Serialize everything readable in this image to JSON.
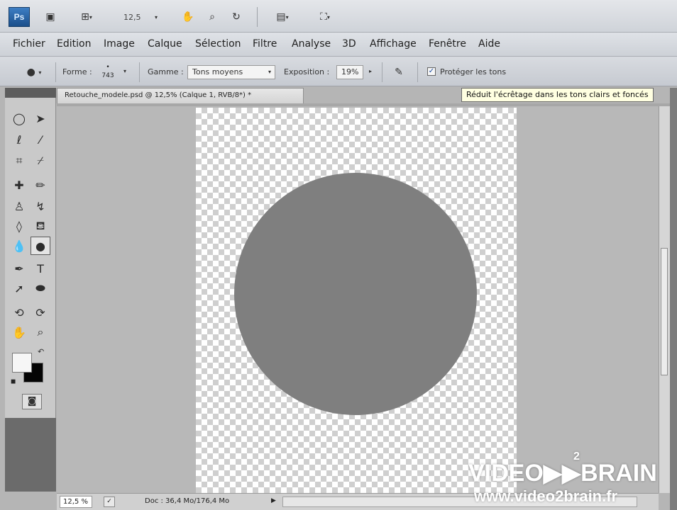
{
  "appbar": {
    "logo": "Ps",
    "zoom": "12,5"
  },
  "menu": {
    "items": [
      "Fichier",
      "Edition",
      "Image",
      "Calque",
      "Sélection",
      "Filtre",
      "Analyse",
      "3D",
      "Affichage",
      "Fenêtre",
      "Aide"
    ]
  },
  "options": {
    "forme_label": "Forme :",
    "brush_size": "743",
    "gamme_label": "Gamme :",
    "gamme_value": "Tons moyens",
    "exposition_label": "Exposition :",
    "exposition_value": "19%",
    "protect_checked": true,
    "protect_label": "Protéger les tons"
  },
  "tooltip": {
    "text": "Réduit l'écrêtage dans les tons clairs et foncés"
  },
  "document": {
    "tab_title": "Retouche_modele.psd @ 12,5% (Calque 1, RVB/8*) *",
    "circle_color": "#7f7f7f"
  },
  "tools": {
    "icons": [
      "marquee-icon",
      "move-icon",
      "lasso-icon",
      "magic-wand-icon",
      "crop-icon",
      "eyedropper-icon",
      "healing-brush-icon",
      "brush-icon",
      "clone-stamp-icon",
      "history-brush-icon",
      "eraser-icon",
      "paint-bucket-icon",
      "blur-icon",
      "sponge-icon",
      "pen-icon",
      "type-icon",
      "path-selection-icon",
      "shape-icon",
      "3d-rotate-icon",
      "3d-orbit-icon",
      "hand-icon",
      "zoom-icon"
    ],
    "active": "sponge-icon"
  },
  "status": {
    "zoom": "12,5 %",
    "doc_info": "Doc : 36,4 Mo/176,4 Mo"
  },
  "watermark": {
    "brand": "VIDEO▶▶BRAIN",
    "superscript": "2",
    "url": "www.video2brain.fr"
  },
  "colors": {
    "foreground": "#f6f6f6",
    "background": "#050505"
  }
}
